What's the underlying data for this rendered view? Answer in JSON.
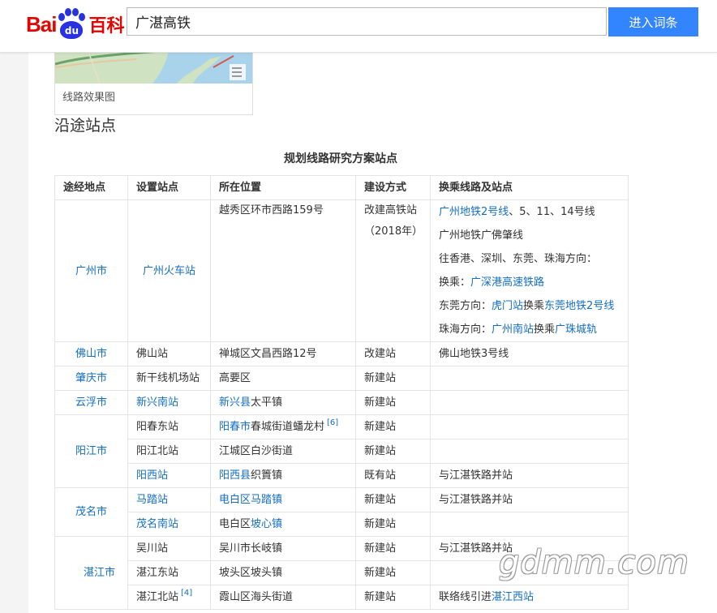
{
  "header": {
    "logo_text_a": "Bai",
    "logo_text_du": "du",
    "logo_text_b": "百科",
    "search_value": "广湛高铁",
    "search_button": "进入词条"
  },
  "thumbnail": {
    "caption": "线路效果图"
  },
  "section": {
    "title": "沿途站点"
  },
  "table": {
    "title": "规划线路研究方案站点",
    "headers": [
      "途经地点",
      "设置站点",
      "所在位置",
      "建设方式",
      "换乘线路及站点"
    ],
    "guangzhou": {
      "city": "广州市",
      "station": "广州火车站",
      "location": "越秀区环市西路159号",
      "build_line1": "改建高铁站",
      "build_line2": "（2018年）",
      "t1_link": "广州地铁2号线",
      "t1_rest": "、5、11、14号线",
      "t2": "广州地铁广佛肇线",
      "t3": "往香港、深圳、东莞、珠海方向：",
      "t4_label": "换乘：",
      "t4_link": "广深港高速铁路",
      "t5_label": "东莞方向：",
      "t5_link1": "虎门站",
      "t5_mid": "换乘",
      "t5_link2": "东莞地铁2号线",
      "t6_label": "珠海方向：",
      "t6_link1": "广州南站",
      "t6_mid": "换乘",
      "t6_link2": "广珠城轨"
    },
    "foshan": {
      "city": "佛山市",
      "station": "佛山站",
      "location": "禅城区文昌西路12号",
      "build": "改建站",
      "transfer": "佛山地铁3号线"
    },
    "zhaoqing": {
      "city": "肇庆市",
      "station": "新干线机场站",
      "location": "高要区",
      "build": "新建站"
    },
    "yunfu": {
      "city": "云浮市",
      "station": "新兴南站",
      "loc_link": "新兴县",
      "loc_rest": "太平镇",
      "build": "新建站"
    },
    "yangjiang": {
      "city": "阳江市",
      "s1": {
        "station": "阳春东站",
        "loc_link": "阳春市",
        "loc_rest": "春城街道蟠龙村",
        "ref": "[6]",
        "build": "新建站"
      },
      "s2": {
        "station": "阳江北站",
        "location": "江城区白沙街道",
        "build": "新建站"
      },
      "s3": {
        "station": "阳西站",
        "loc_link": "阳西县",
        "loc_rest": "织篢镇",
        "build": "既有站",
        "transfer": "与江湛铁路并站"
      }
    },
    "maoming": {
      "city": "茂名市",
      "s1": {
        "station": "马踏站",
        "loc_link": "电白区马踏镇",
        "build": "新建站",
        "transfer": "与江湛铁路并站"
      },
      "s2": {
        "station": "茂名南站",
        "loc_a": "电白区",
        "loc_link": "坡心镇",
        "build": "新建站"
      }
    },
    "zhanjiang": {
      "city": "湛江市",
      "s1": {
        "station": "吴川站",
        "location": "吴川市长岐镇",
        "build": "新建站",
        "transfer": "与江湛铁路并站"
      },
      "s2": {
        "station": "湛江东站",
        "location": "坡头区坡头镇",
        "build": "新建站"
      },
      "s3": {
        "station": "湛江北站",
        "ref": "[4]",
        "location": "霞山区海头街道",
        "build": "新建站",
        "transfer_a": "联络线引进",
        "transfer_link": "湛江西站"
      }
    }
  },
  "watermark": "gdmm.com"
}
